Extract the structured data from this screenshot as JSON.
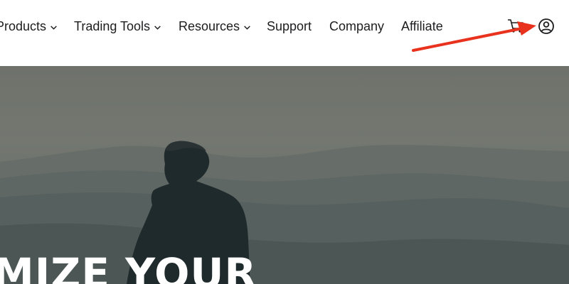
{
  "nav": {
    "items": [
      {
        "label": "Products",
        "has_dropdown": true
      },
      {
        "label": "Trading Tools",
        "has_dropdown": true
      },
      {
        "label": "Resources",
        "has_dropdown": true
      },
      {
        "label": "Support",
        "has_dropdown": false
      },
      {
        "label": "Company",
        "has_dropdown": false
      },
      {
        "label": "Affiliate",
        "has_dropdown": false
      }
    ],
    "icons": {
      "cart": "cart-icon",
      "account": "user-circle-icon"
    }
  },
  "hero": {
    "headline": "MIZE YOUR"
  },
  "colors": {
    "nav_text": "#1d1d1f",
    "annotation_arrow": "#e8321e",
    "hero_overlay": "#6e726b",
    "headline": "#ffffff"
  }
}
